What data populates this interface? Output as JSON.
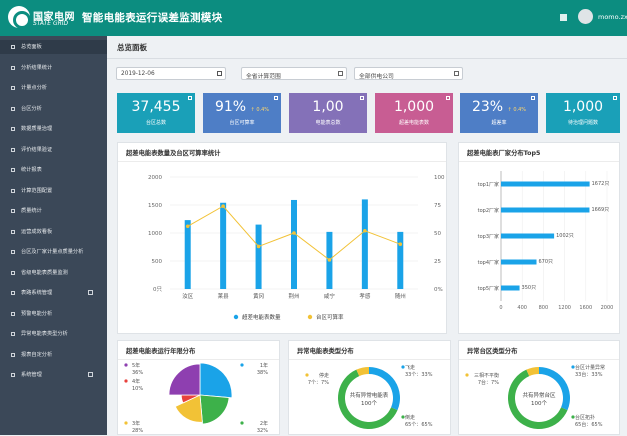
{
  "header": {
    "brand_cn": "国家电网",
    "brand_en": "STATE GRID",
    "app_title": "智能电能表运行误差监测模块",
    "username": "momo.zx"
  },
  "sidebar": {
    "items": [
      {
        "label": "总览面板",
        "active": true
      },
      {
        "label": "分析结果统计"
      },
      {
        "label": "计量点分析"
      },
      {
        "label": "台区分析"
      },
      {
        "label": "数据质量治理"
      },
      {
        "label": "评价结果验证"
      },
      {
        "label": "统计报表"
      },
      {
        "label": "计算范围配置"
      },
      {
        "label": "质量统计"
      },
      {
        "label": "运营成效看板"
      },
      {
        "label": "台区及厂家计量点质量分析"
      },
      {
        "label": "省级电能表质量监测"
      },
      {
        "label": "表路系统管理"
      },
      {
        "label": "预警电能分析"
      },
      {
        "label": "异常电能表类型分析"
      },
      {
        "label": "报表自定分析"
      },
      {
        "label": "系统管理"
      }
    ]
  },
  "main": {
    "page_title": "总览面板",
    "filters": {
      "date": "2019-12-06",
      "scope": "全省计算范围",
      "company": "全部供电公司"
    },
    "kpis": [
      {
        "value": "37,455",
        "label": "台区总数",
        "color": "#1aa0b8"
      },
      {
        "value": "91%",
        "sub": "↑ 0.4%",
        "label": "台区可算率",
        "color": "#4e7ec6"
      },
      {
        "value": "1,00",
        "label": "电能表总数",
        "color": "#8471b8"
      },
      {
        "value": "1,000",
        "label": "超差电能表数",
        "color": "#c85d93"
      },
      {
        "value": "23%",
        "sub": "↑ 0.4%",
        "label": "超差率",
        "color": "#4e7ec6"
      },
      {
        "value": "1,000",
        "label": "待治理问题数",
        "color": "#1aa0b8"
      }
    ]
  },
  "panels": {
    "bar_title": "超差电能表数量及台区可算率统计",
    "factory_title": "超差电能表厂家分布Top5",
    "years_title": "超差电能表运行年限分布",
    "type_title": "异常电能表类型分布",
    "area_title": "异常台区类型分布"
  },
  "chart_data": [
    {
      "type": "bar",
      "title": "超差电能表数量及台区可算率统计",
      "categories": [
        "汝区",
        "莱县",
        "黄冈",
        "荆州",
        "咸宁",
        "孝感",
        "随州"
      ],
      "series": [
        {
          "name": "超差电能表数量",
          "type": "bar",
          "values": [
            1230,
            1540,
            1150,
            1590,
            1020,
            1600,
            1020
          ],
          "color": "#1aa3e8"
        },
        {
          "name": "台区可算率",
          "type": "line",
          "axis": "right",
          "values": [
            56,
            74,
            38,
            50,
            26,
            52,
            40
          ],
          "color": "#f2c236"
        }
      ],
      "yleft_ticks": [
        "0只",
        "500",
        "1000",
        "1500",
        "2000"
      ],
      "yright_ticks": [
        "0%",
        "25",
        "50",
        "75",
        "100"
      ],
      "ylim_left": [
        0,
        2000
      ],
      "ylim_right": [
        0,
        100
      ],
      "grid": true,
      "legend": "bottom"
    },
    {
      "type": "bar",
      "orientation": "horizontal",
      "title": "超差电能表厂家分布Top5",
      "categories": [
        "top1厂家",
        "top2厂家",
        "top3厂家",
        "top4厂家",
        "top5厂家"
      ],
      "values": [
        1672,
        1669,
        1002,
        670,
        350
      ],
      "value_labels": [
        "1672只",
        "1669只",
        "1002只",
        "670只",
        "350只"
      ],
      "xticks": [
        "0",
        "400",
        "800",
        "1200",
        "1600",
        "2000"
      ],
      "xlim": [
        0,
        2000
      ],
      "color": "#1aa3e8"
    },
    {
      "type": "pie",
      "title": "超差电能表运行年限分布",
      "slices": [
        {
          "label": "1年",
          "percent": 38,
          "color": "#1aa3e8"
        },
        {
          "label": "2年",
          "percent": 32,
          "color": "#3db14a"
        },
        {
          "label": "3年",
          "percent": 28,
          "color": "#f2c236"
        },
        {
          "label": "4年",
          "percent": 10,
          "color": "#e8413c"
        },
        {
          "label": "5年",
          "percent": 36,
          "color": "#8e3fb0"
        }
      ]
    },
    {
      "type": "pie",
      "donut": true,
      "title": "异常电能表类型分布",
      "center_text": "共有异常电能表",
      "center_value": "100个",
      "slices": [
        {
          "label": "飞走",
          "value_text": "33个：33%",
          "value": 33,
          "color": "#1aa3e8"
        },
        {
          "label": "倒走",
          "value_text": "65个：65%",
          "value": 65,
          "color": "#3db14a"
        },
        {
          "label": "停走",
          "value_text": "7个：7%",
          "value": 7,
          "color": "#f2c236"
        }
      ]
    },
    {
      "type": "pie",
      "donut": true,
      "title": "异常台区类型分布",
      "center_text": "共有异常台区",
      "center_value": "100个",
      "slices": [
        {
          "label": "台区计量异常",
          "value_text": "33台：33%",
          "value": 33,
          "color": "#1aa3e8"
        },
        {
          "label": "台区拓扑",
          "value_text": "65台：65%",
          "value": 65,
          "color": "#3db14a"
        },
        {
          "label": "三相不平衡",
          "value_text": "7台：7%",
          "value": 7,
          "color": "#f2c236"
        }
      ]
    }
  ]
}
